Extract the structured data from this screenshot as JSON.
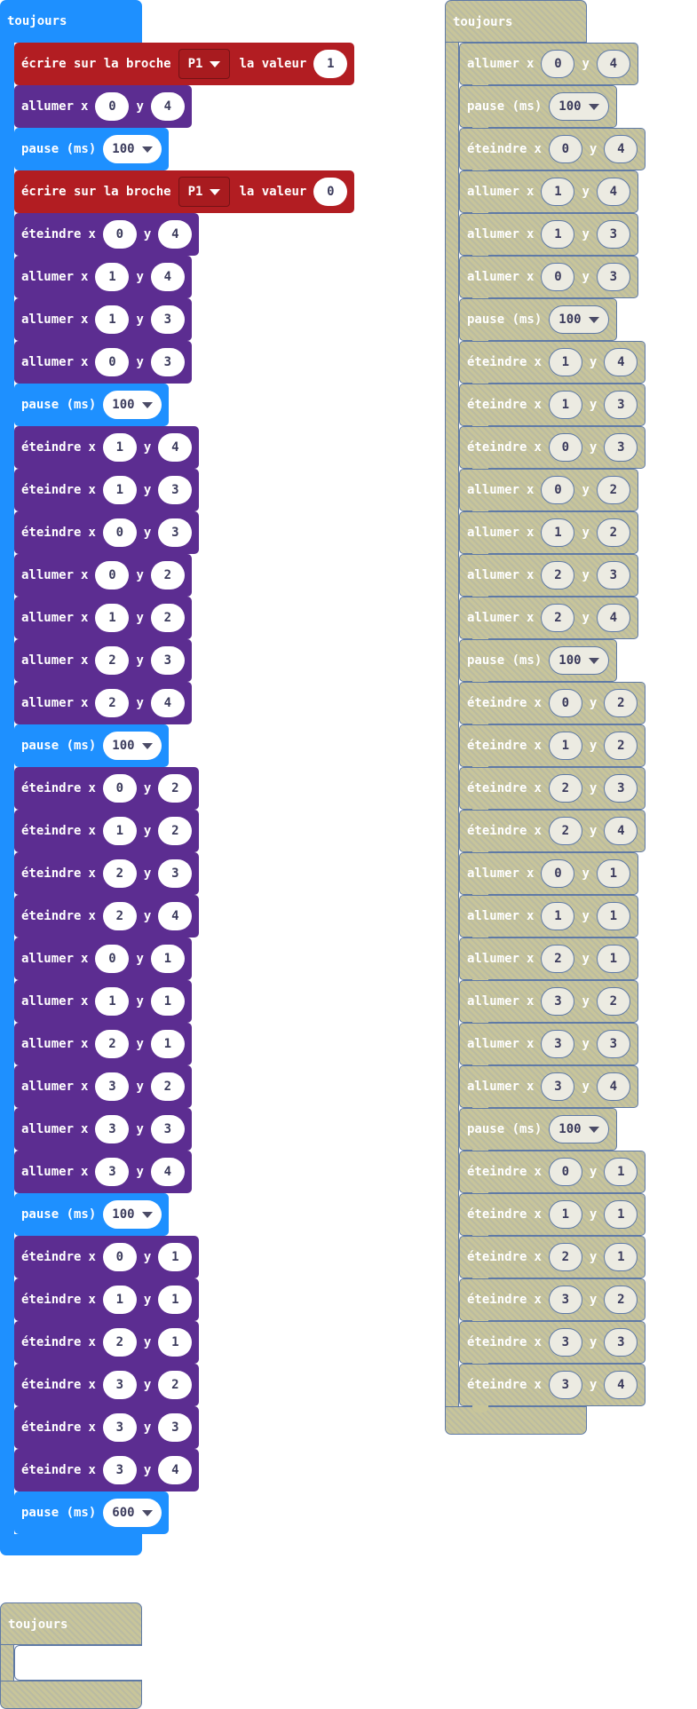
{
  "colors": {
    "basic": "#1e90ff",
    "led": "#5c2d91",
    "pins": "#b21d22",
    "disabled": "#c8c59a",
    "disabled_border": "#5f7aa6"
  },
  "stacks": [
    {
      "id": "main",
      "title": "toujours",
      "disabled": false,
      "blocks": [
        {
          "type": "pin",
          "label": "écrire sur la broche",
          "pin": "P1",
          "label2": "la valeur",
          "value": "1"
        },
        {
          "type": "led",
          "label": "allumer",
          "x": "0",
          "y": "4"
        },
        {
          "type": "pause",
          "label": "pause (ms)",
          "value": "100"
        },
        {
          "type": "pin",
          "label": "écrire sur la broche",
          "pin": "P1",
          "label2": "la valeur",
          "value": "0"
        },
        {
          "type": "led",
          "label": "éteindre",
          "x": "0",
          "y": "4"
        },
        {
          "type": "led",
          "label": "allumer",
          "x": "1",
          "y": "4"
        },
        {
          "type": "led",
          "label": "allumer",
          "x": "1",
          "y": "3"
        },
        {
          "type": "led",
          "label": "allumer",
          "x": "0",
          "y": "3"
        },
        {
          "type": "pause",
          "label": "pause (ms)",
          "value": "100"
        },
        {
          "type": "led",
          "label": "éteindre",
          "x": "1",
          "y": "4"
        },
        {
          "type": "led",
          "label": "éteindre",
          "x": "1",
          "y": "3"
        },
        {
          "type": "led",
          "label": "éteindre",
          "x": "0",
          "y": "3"
        },
        {
          "type": "led",
          "label": "allumer",
          "x": "0",
          "y": "2"
        },
        {
          "type": "led",
          "label": "allumer",
          "x": "1",
          "y": "2"
        },
        {
          "type": "led",
          "label": "allumer",
          "x": "2",
          "y": "3"
        },
        {
          "type": "led",
          "label": "allumer",
          "x": "2",
          "y": "4"
        },
        {
          "type": "pause",
          "label": "pause (ms)",
          "value": "100"
        },
        {
          "type": "led",
          "label": "éteindre",
          "x": "0",
          "y": "2"
        },
        {
          "type": "led",
          "label": "éteindre",
          "x": "1",
          "y": "2"
        },
        {
          "type": "led",
          "label": "éteindre",
          "x": "2",
          "y": "3"
        },
        {
          "type": "led",
          "label": "éteindre",
          "x": "2",
          "y": "4"
        },
        {
          "type": "led",
          "label": "allumer",
          "x": "0",
          "y": "1"
        },
        {
          "type": "led",
          "label": "allumer",
          "x": "1",
          "y": "1"
        },
        {
          "type": "led",
          "label": "allumer",
          "x": "2",
          "y": "1"
        },
        {
          "type": "led",
          "label": "allumer",
          "x": "3",
          "y": "2"
        },
        {
          "type": "led",
          "label": "allumer",
          "x": "3",
          "y": "3"
        },
        {
          "type": "led",
          "label": "allumer",
          "x": "3",
          "y": "4"
        },
        {
          "type": "pause",
          "label": "pause (ms)",
          "value": "100"
        },
        {
          "type": "led",
          "label": "éteindre",
          "x": "0",
          "y": "1"
        },
        {
          "type": "led",
          "label": "éteindre",
          "x": "1",
          "y": "1"
        },
        {
          "type": "led",
          "label": "éteindre",
          "x": "2",
          "y": "1"
        },
        {
          "type": "led",
          "label": "éteindre",
          "x": "3",
          "y": "2"
        },
        {
          "type": "led",
          "label": "éteindre",
          "x": "3",
          "y": "3"
        },
        {
          "type": "led",
          "label": "éteindre",
          "x": "3",
          "y": "4"
        },
        {
          "type": "pause",
          "label": "pause (ms)",
          "value": "600"
        }
      ]
    },
    {
      "id": "disabled-right",
      "title": "toujours",
      "disabled": true,
      "blocks": [
        {
          "type": "led",
          "label": "allumer",
          "x": "0",
          "y": "4"
        },
        {
          "type": "pause",
          "label": "pause (ms)",
          "value": "100"
        },
        {
          "type": "led",
          "label": "éteindre",
          "x": "0",
          "y": "4"
        },
        {
          "type": "led",
          "label": "allumer",
          "x": "1",
          "y": "4"
        },
        {
          "type": "led",
          "label": "allumer",
          "x": "1",
          "y": "3"
        },
        {
          "type": "led",
          "label": "allumer",
          "x": "0",
          "y": "3"
        },
        {
          "type": "pause",
          "label": "pause (ms)",
          "value": "100"
        },
        {
          "type": "led",
          "label": "éteindre",
          "x": "1",
          "y": "4"
        },
        {
          "type": "led",
          "label": "éteindre",
          "x": "1",
          "y": "3"
        },
        {
          "type": "led",
          "label": "éteindre",
          "x": "0",
          "y": "3"
        },
        {
          "type": "led",
          "label": "allumer",
          "x": "0",
          "y": "2"
        },
        {
          "type": "led",
          "label": "allumer",
          "x": "1",
          "y": "2"
        },
        {
          "type": "led",
          "label": "allumer",
          "x": "2",
          "y": "3"
        },
        {
          "type": "led",
          "label": "allumer",
          "x": "2",
          "y": "4"
        },
        {
          "type": "pause",
          "label": "pause (ms)",
          "value": "100"
        },
        {
          "type": "led",
          "label": "éteindre",
          "x": "0",
          "y": "2"
        },
        {
          "type": "led",
          "label": "éteindre",
          "x": "1",
          "y": "2"
        },
        {
          "type": "led",
          "label": "éteindre",
          "x": "2",
          "y": "3"
        },
        {
          "type": "led",
          "label": "éteindre",
          "x": "2",
          "y": "4"
        },
        {
          "type": "led",
          "label": "allumer",
          "x": "0",
          "y": "1"
        },
        {
          "type": "led",
          "label": "allumer",
          "x": "1",
          "y": "1"
        },
        {
          "type": "led",
          "label": "allumer",
          "x": "2",
          "y": "1"
        },
        {
          "type": "led",
          "label": "allumer",
          "x": "3",
          "y": "2"
        },
        {
          "type": "led",
          "label": "allumer",
          "x": "3",
          "y": "3"
        },
        {
          "type": "led",
          "label": "allumer",
          "x": "3",
          "y": "4"
        },
        {
          "type": "pause",
          "label": "pause (ms)",
          "value": "100"
        },
        {
          "type": "led",
          "label": "éteindre",
          "x": "0",
          "y": "1"
        },
        {
          "type": "led",
          "label": "éteindre",
          "x": "1",
          "y": "1"
        },
        {
          "type": "led",
          "label": "éteindre",
          "x": "2",
          "y": "1"
        },
        {
          "type": "led",
          "label": "éteindre",
          "x": "3",
          "y": "2"
        },
        {
          "type": "led",
          "label": "éteindre",
          "x": "3",
          "y": "3"
        },
        {
          "type": "led",
          "label": "éteindre",
          "x": "3",
          "y": "4"
        }
      ]
    },
    {
      "id": "disabled-empty",
      "title": "toujours",
      "disabled": true,
      "blocks": []
    }
  ]
}
